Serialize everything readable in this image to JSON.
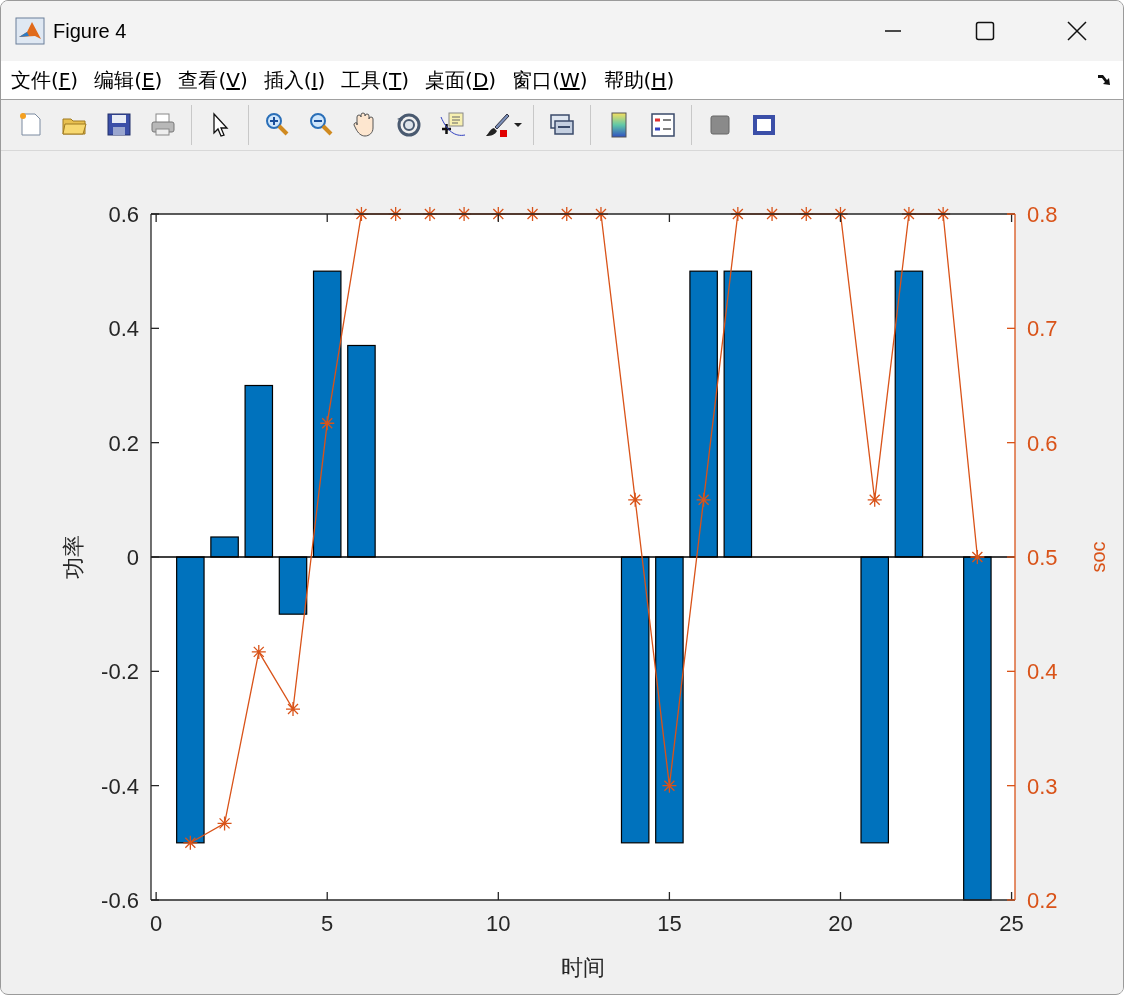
{
  "window": {
    "title": "Figure 4"
  },
  "menu": [
    "文件(F)",
    "编辑(E)",
    "查看(V)",
    "插入(I)",
    "工具(T)",
    "桌面(D)",
    "窗口(W)",
    "帮助(H)"
  ],
  "chart_data": {
    "type": "bar",
    "xlabel": "时间",
    "ylabel": "功率",
    "y2label": "soc",
    "x": [
      1,
      2,
      3,
      4,
      5,
      6,
      7,
      8,
      9,
      10,
      11,
      12,
      13,
      14,
      15,
      16,
      17,
      18,
      19,
      20,
      21,
      22,
      23,
      24
    ],
    "series": [
      {
        "color": "#0072bd",
        "values": [
          -0.5,
          0.035,
          0.3,
          -0.1,
          0.5,
          0.37,
          0,
          0,
          0,
          0,
          0,
          0,
          0,
          -0.5,
          -0.5,
          0.5,
          0.5,
          0,
          0,
          0,
          -0.5,
          0.5,
          0,
          -0.6
        ]
      },
      {
        "type": "line",
        "axis": "y2",
        "marker": "cross",
        "color": "#d95319",
        "values": [
          0.25,
          0.267,
          0.417,
          0.367,
          0.617,
          0.8,
          0.8,
          0.8,
          0.8,
          0.8,
          0.8,
          0.8,
          0.8,
          0.55,
          0.3,
          0.55,
          0.8,
          0.8,
          0.8,
          0.8,
          0.55,
          0.8,
          0.8,
          0.5
        ]
      }
    ],
    "xlim": [
      -0.15,
      25.1
    ],
    "ylim": [
      -0.6,
      0.6
    ],
    "y2lim": [
      0.2,
      0.8
    ],
    "xticks": [
      0,
      5,
      10,
      15,
      20,
      25
    ],
    "yticks": [
      {
        "value": -0.6,
        "label": "-0.6"
      },
      {
        "value": -0.4,
        "label": "-0.4"
      },
      {
        "value": -0.2,
        "label": "-0.2"
      },
      {
        "value": 0,
        "label": "0"
      },
      {
        "value": 0.2,
        "label": "0.2"
      },
      {
        "value": 0.4,
        "label": "0.4"
      },
      {
        "value": 0.6,
        "label": "0.6"
      }
    ],
    "y2ticks": [
      0.2,
      0.3,
      0.4,
      0.5,
      0.6,
      0.7,
      0.8
    ]
  }
}
